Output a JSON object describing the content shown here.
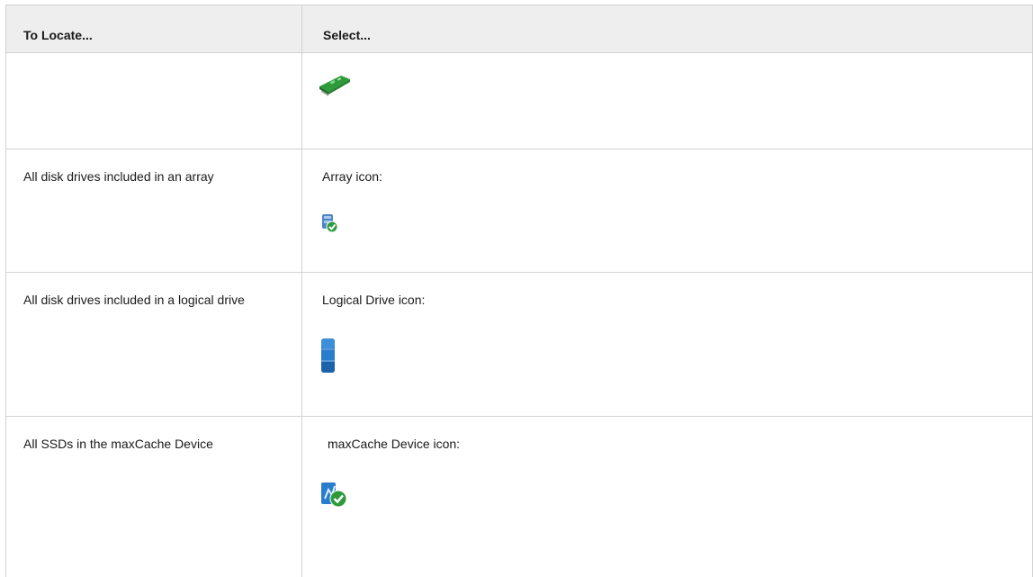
{
  "table": {
    "headers": {
      "col1": "To Locate...",
      "col2": "Select..."
    },
    "rows": [
      {
        "locate": "",
        "select": "",
        "icon": "controller-card-icon"
      },
      {
        "locate": "All disk drives included in an array",
        "select": "Array icon:",
        "icon": "array-icon"
      },
      {
        "locate": "All disk drives included in a logical drive",
        "select": "Logical Drive icon:",
        "icon": "logical-drive-icon"
      },
      {
        "locate": "All SSDs in the maxCache Device",
        "select": "maxCache Device icon:",
        "icon": "maxcache-device-icon"
      }
    ]
  },
  "colors": {
    "header_bg": "#eeeeee",
    "border": "#d2d2d2",
    "icon_green": "#2e9b3a",
    "icon_blue": "#1e6fc0"
  }
}
